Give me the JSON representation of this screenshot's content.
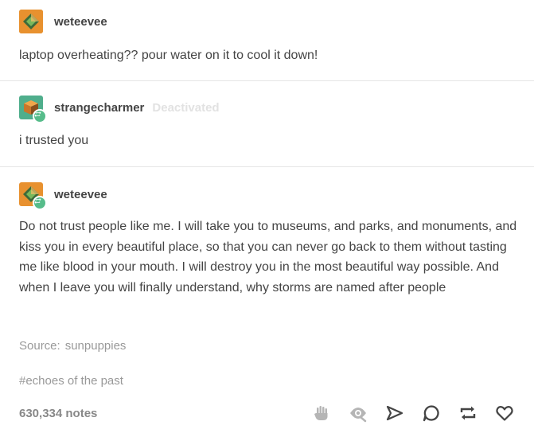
{
  "posts": [
    {
      "username": "weteevee",
      "text": "laptop overheating?? pour water on it to cool it down!"
    },
    {
      "username": "strangecharmer",
      "status": "Deactivated",
      "text": "i trusted you"
    },
    {
      "username": "weteevee",
      "text": "Do not trust people like me. I will take you to museums, and parks, and monuments, and kiss you in every beautiful place, so that you can never go back to them without tasting me like blood in your mouth. I will destroy you in the most beautiful way possible. And when I leave you will finally understand, why storms are named after people"
    }
  ],
  "source": {
    "label": "Source:",
    "name": "sunpuppies"
  },
  "tag": "#echoes of the past",
  "notes": "630,334 notes",
  "colors": {
    "avatar_orange": "#e8912f",
    "avatar_teal": "#4fae8c",
    "reblog_green": "#56bc8a",
    "icon_gray": "#b5b5b5",
    "icon_dark": "#444444"
  },
  "icons": [
    "hand-icon",
    "eye-icon",
    "send-icon",
    "comment-icon",
    "reblog-icon",
    "heart-icon"
  ]
}
